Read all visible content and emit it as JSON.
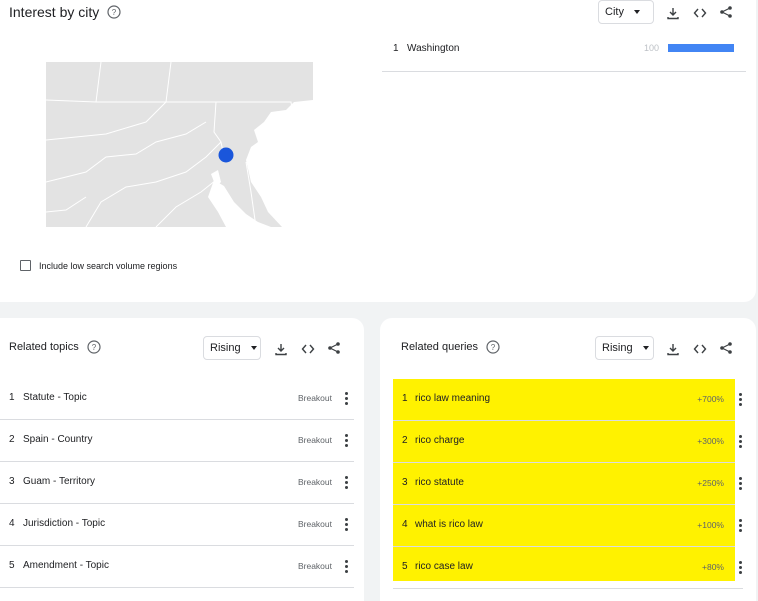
{
  "city_card": {
    "title": "Interest by city",
    "dropdown": "City",
    "checkbox_label": "Include low search volume regions",
    "rows": [
      {
        "rank": "1",
        "name": "Washington",
        "value": "100",
        "fill": 1.0
      }
    ]
  },
  "topics_card": {
    "title": "Related topics",
    "dropdown": "Rising",
    "rows": [
      {
        "rank": "1",
        "label": "Statute - Topic",
        "value": "Breakout"
      },
      {
        "rank": "2",
        "label": "Spain - Country",
        "value": "Breakout"
      },
      {
        "rank": "3",
        "label": "Guam - Territory",
        "value": "Breakout"
      },
      {
        "rank": "4",
        "label": "Jurisdiction - Topic",
        "value": "Breakout"
      },
      {
        "rank": "5",
        "label": "Amendment - Topic",
        "value": "Breakout"
      }
    ]
  },
  "queries_card": {
    "title": "Related queries",
    "dropdown": "Rising",
    "highlight_color": "#fff200",
    "rows": [
      {
        "rank": "1",
        "label": "rico law meaning",
        "value": "+700%"
      },
      {
        "rank": "2",
        "label": "rico charge",
        "value": "+300%"
      },
      {
        "rank": "3",
        "label": "rico statute",
        "value": "+250%"
      },
      {
        "rank": "4",
        "label": "what is rico law",
        "value": "+100%"
      },
      {
        "rank": "5",
        "label": "rico case law",
        "value": "+80%"
      }
    ]
  },
  "icons": {
    "help": "help-circle-icon",
    "download": "download-icon",
    "embed": "code-embed-icon",
    "share": "share-icon",
    "more": "more-vert-icon"
  },
  "colors": {
    "accent": "#4285f4",
    "map_marker": "#1a56db"
  }
}
